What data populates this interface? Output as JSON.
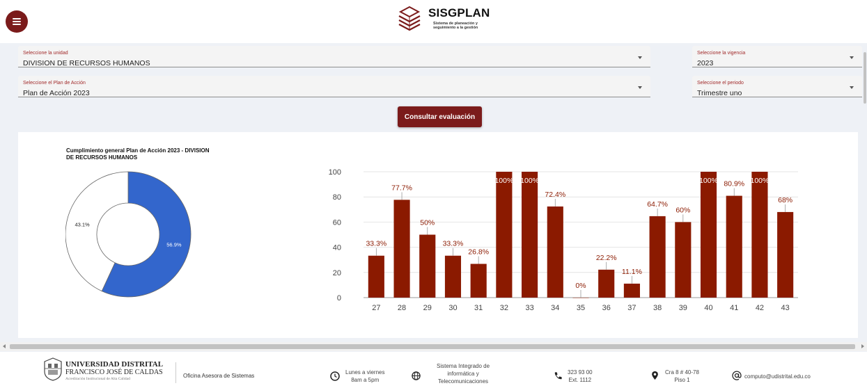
{
  "header": {
    "menu_icon": "hamburger-menu-icon",
    "logo_icon": "stacked-layers-icon",
    "app_name": "SISGPLAN",
    "app_subtitle": "Sistema de planeación y seguimiento a la gestión"
  },
  "filters": {
    "unidad": {
      "label": "Seleccione la unidad",
      "value": "DIVISION DE RECURSOS HUMANOS"
    },
    "vigencia": {
      "label": "Seleccione la vigencia",
      "value": "2023"
    },
    "plan": {
      "label": "Seleccione el Plan de Acción",
      "value": "Plan de Acción 2023"
    },
    "periodo": {
      "label": "Seleccione el periodo",
      "value": "Trimestre uno"
    },
    "consult_button": "Consultar evaluación"
  },
  "colors": {
    "brand": "#7b1b1b",
    "bar": "#8b1a00",
    "donut_fill": "#3366cc",
    "donut_empty": "#ffffff"
  },
  "chart_data": [
    {
      "type": "pie",
      "title": "Cumplimiento general Plan de Acción 2023 - DIVISION DE RECURSOS HUMANOS",
      "slices": [
        {
          "value": 56.9,
          "label": "56.9%",
          "color": "#3366cc"
        },
        {
          "value": 43.1,
          "label": "43.1%",
          "color": "#ffffff"
        }
      ],
      "hole": 0.5
    },
    {
      "type": "bar",
      "categories": [
        "27",
        "28",
        "29",
        "30",
        "31",
        "32",
        "33",
        "34",
        "35",
        "36",
        "37",
        "38",
        "39",
        "40",
        "41",
        "42",
        "43"
      ],
      "values": [
        33.3,
        77.7,
        50,
        33.3,
        26.8,
        100,
        100,
        72.4,
        0,
        22.2,
        11.1,
        64.7,
        60,
        100,
        80.9,
        100,
        68
      ],
      "data_labels": [
        "33.3%",
        "77.7%",
        "50%",
        "33.3%",
        "26.8%",
        "100%",
        "100%",
        "72.4%",
        "0%",
        "22.2%",
        "11.1%",
        "64.7%",
        "60%",
        "100%",
        "80.9%",
        "100%",
        "68%"
      ],
      "ylim": [
        0,
        100
      ],
      "yticks": [
        "0",
        "20",
        "40",
        "60",
        "80",
        "100"
      ],
      "grid": true
    }
  ],
  "footer": {
    "university_line1": "UNIVERSIDAD DISTRITAL",
    "university_line2": "FRANCISCO JOSÉ DE CALDAS",
    "university_line3": "Acreditación Institucional de Alta Calidad",
    "office": "Oficina Asesora de Sistemas",
    "hours_icon": "clock-icon",
    "hours": [
      "Lunes a viernes",
      "8am a 5pm"
    ],
    "system_icon": "globe-icon",
    "system": [
      "Sistema Integrado de",
      "informática y",
      "Telecomunicaciones"
    ],
    "phone_icon": "phone-icon",
    "phone": [
      "323 93 00",
      "Ext. 1112"
    ],
    "address_icon": "location-pin-icon",
    "address": [
      "Cra 8 # 40-78",
      "Piso 1"
    ],
    "email_icon": "at-sign-icon",
    "email": "computo@udistrital.edu.co"
  }
}
